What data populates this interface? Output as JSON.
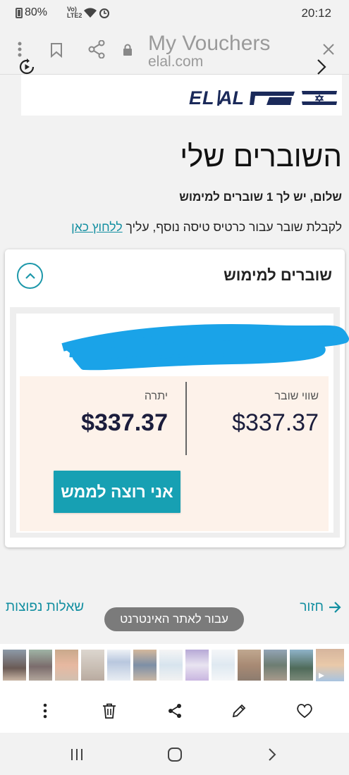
{
  "status": {
    "battery": "80%",
    "network_top": "Vo)",
    "network_bottom": "LTE2",
    "time": "20:12"
  },
  "browser": {
    "title": "My Vouchers",
    "domain": "elal.com"
  },
  "page": {
    "heading": "השוברים שלי",
    "greeting": "שלום, יש לך 1 שוברים למימוש",
    "info_prefix": "לקבלת שובר עבור כרטיס טיסה נוסף, עליך ",
    "info_link": "ללחוץ כאן",
    "card_title": "שוברים למימוש",
    "voucher_value_label": "שווי שובר",
    "voucher_value": "$337.37",
    "balance_label": "יתרה",
    "balance_value": "$337.37",
    "redeem_button": "אני רוצה לממש",
    "back_link": "חזור",
    "faq_link": "שאלות נפוצות"
  },
  "toast": "עבור לאתר האינטרנט",
  "colors": {
    "accent": "#17a0b3",
    "link": "#138fa1",
    "logo_navy": "#1b2a5a",
    "redaction": "#1aa3e8"
  },
  "toolbar_icons": [
    "more-vertical-icon",
    "trash-icon",
    "share-icon",
    "pencil-icon",
    "heart-icon"
  ]
}
